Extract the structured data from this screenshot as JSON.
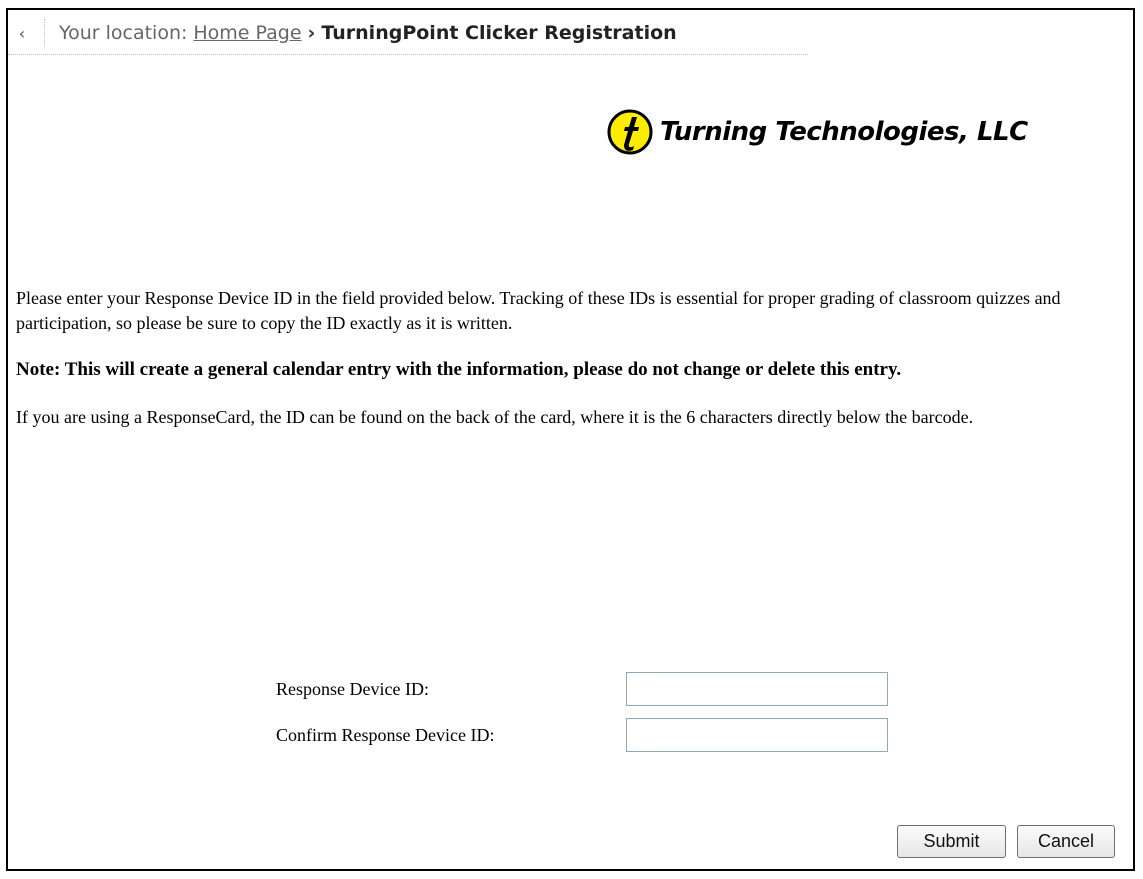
{
  "breadcrumb": {
    "back_glyph": "‹",
    "label": "Your location:",
    "home_link": "Home Page",
    "separator": "›",
    "current": "TurningPoint Clicker Registration"
  },
  "logo": {
    "text": "Turning Technologies, LLC",
    "mark_color": "#ffec00"
  },
  "content": {
    "paragraph1": "Please enter your Response Device ID in the field provided below. Tracking of these IDs is essential for proper grading of classroom quizzes and participation, so please be sure to copy the ID exactly as it is written.",
    "note": "Note: This will create a general calendar entry with the information, please do not change or delete this entry.",
    "paragraph2": "If you are using a ResponseCard, the ID can be found on the back of the card, where it is the 6 characters directly below the barcode."
  },
  "form": {
    "device_id_label": "Response Device ID:",
    "device_id_value": "",
    "confirm_label": "Confirm Response Device ID:",
    "confirm_value": ""
  },
  "buttons": {
    "submit": "Submit",
    "cancel": "Cancel"
  }
}
